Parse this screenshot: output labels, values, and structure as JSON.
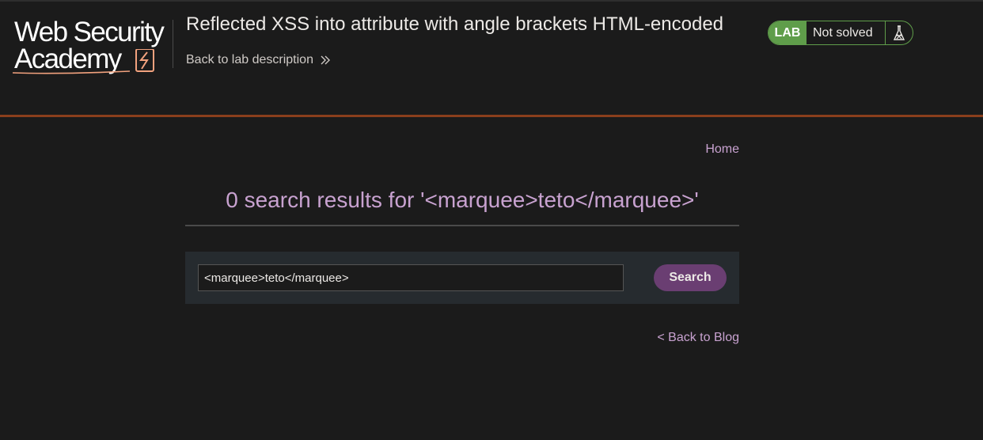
{
  "header": {
    "logo_line1": "Web Security",
    "logo_line2": "Academy",
    "lab_title": "Reflected XSS into attribute with angle brackets HTML-encoded",
    "back_to_lab": "Back to lab description",
    "status": {
      "badge": "LAB",
      "text": "Not solved",
      "icon": "flask-icon"
    }
  },
  "nav": {
    "home": "Home"
  },
  "results": {
    "heading": "0 search results for '<marquee>teto</marquee>'"
  },
  "search": {
    "value": "<marquee>teto</marquee>",
    "button": "Search"
  },
  "footer": {
    "back_to_blog": "< Back to Blog"
  },
  "colors": {
    "background": "#1b1b1b",
    "accent_rule": "#8a3e1c",
    "link_purple": "#c8a2d0",
    "lab_green": "#5f9d4a",
    "button_purple": "#6a3e72",
    "panel": "#262b2f"
  }
}
